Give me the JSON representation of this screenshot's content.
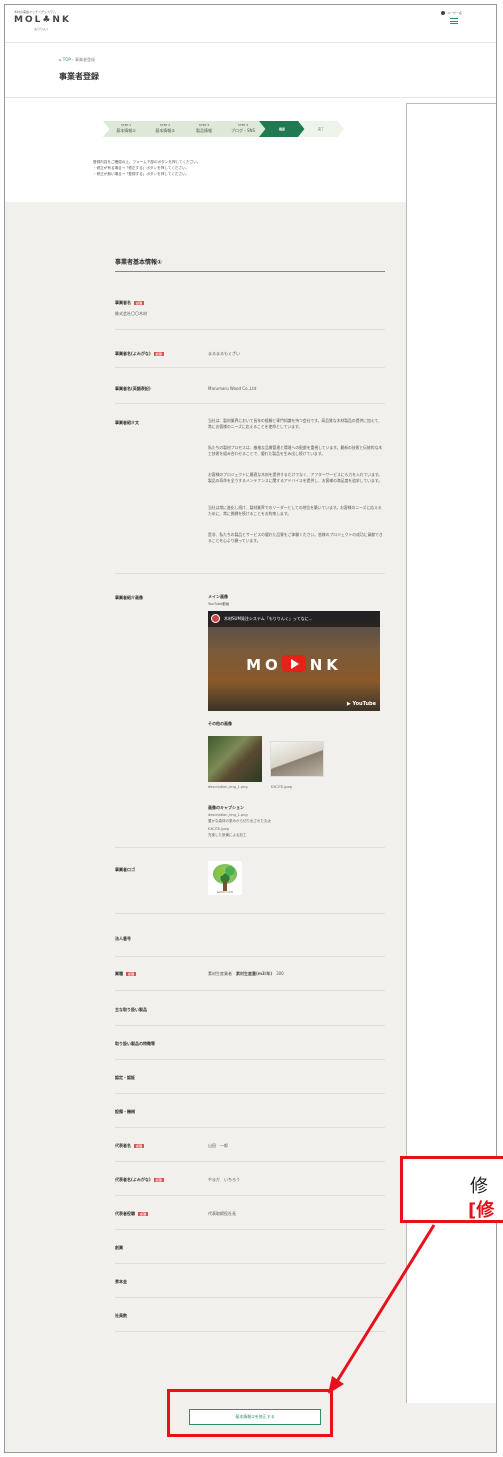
{
  "header": {
    "logo_top": "木材の需給マッチングシステム",
    "logo": "MOL♣NK",
    "logo_sub": "もりりんく",
    "user_label": "ユーザー名"
  },
  "breadcrumb": {
    "home": "⌂ TOP",
    "sep": "›",
    "current": "事業者登録"
  },
  "page_title": "事業者登録",
  "steps": [
    {
      "num": "STEP 1",
      "label": "基本情報①"
    },
    {
      "num": "STEP 2",
      "label": "基本情報②"
    },
    {
      "num": "STEP 3",
      "label": "製品情報"
    },
    {
      "num": "STEP 4",
      "label": "ブログ・SNS"
    },
    {
      "num": "",
      "label": "確認"
    },
    {
      "num": "",
      "label": "完了"
    }
  ],
  "instructions": [
    "登録内容をご確認の上、フォーム下部のボタンを押してください。",
    "・修正が有る場合→「修正する」ボタンを押してください。",
    "・修正が無い場合→「登録する」ボタンを押してください。"
  ],
  "section_title": "事業者基本情報①",
  "required_badge": "必須",
  "fields": {
    "company_name": {
      "label": "事業者名",
      "value": "株式会社〇〇木材"
    },
    "company_kana": {
      "label": "事業者名(よみがな)",
      "value": "まるまるもくざい"
    },
    "company_en": {
      "label": "事業者名(英語表記)",
      "value": "Marumaru Wood Co.,Ltd"
    },
    "intro": {
      "label": "事業者紹介文",
      "paragraphs": [
        "当社は、製材業界において長年の経験と専門知識を持つ会社です。高品質な木材製品の提供に加えて、常にお客様のニーズに応えることを使命としています。",
        "私たちの製材プロセスは、厳格な品質管理と環境への配慮を重視しています。最新の技術と伝統的な木工技術を組み合わせることで、優れた製品を生み出し続けています。",
        "お客様のプロジェクトに最適な木材を提供するだけでなく、アフターサービスにも力を入れています。製品の寿命を全うするメンテナンスに関するアドバイスを提供し、お客様の満足度を追求しています。",
        "当社は常に進化し続け、製材業界でのリーダーとしての地位を築いています。お客様のニーズに応えるために、常に挑戦を続けることをお約束します。",
        "是非、私たちの製品とサービスの優れた品質をご体験ください。皆様のプロジェクトの成功に貢献できることを心より願っています。"
      ]
    },
    "intro_image": {
      "label": "事業者紹介画像",
      "main_label": "メイン画像",
      "youtube_label": "YouTube動画",
      "video_title": "木材SUM発注システム「もりりんく」ってなに...",
      "video_logo_left": "MO",
      "video_logo_right": "NK",
      "youtube_mark": "▶ YouTube",
      "others_label": "その他の画像",
      "img1_caption": "description_img_1.png",
      "img2_caption": "EXCITE.jpeg",
      "caption_label": "画像のキャプション",
      "captions": [
        "description_img_1.png",
        "豊かな森林の恵みから切り出された丸太",
        "EXCITE.jpeg",
        "充実した設備による加工"
      ]
    },
    "logo": {
      "label": "事業者ロゴ",
      "logo_text": "株式会社〇〇木材"
    },
    "corp_number": {
      "label": "法人番号"
    },
    "business": {
      "label": "業種",
      "value1": "素材生産業者",
      "value2_label": "素材生産量(m3/年)",
      "value2": "300"
    },
    "main_products": {
      "label": "主な取り扱い製品"
    },
    "features": {
      "label": "取り扱い製品の特徴等"
    },
    "certs": {
      "label": "認定・認証"
    },
    "equipment": {
      "label": "設備・機械"
    },
    "rep_name": {
      "label": "代表者名",
      "value": "山田　一郎"
    },
    "rep_kana": {
      "label": "代表者名(よみがな)",
      "value": "やまだ　いちろう"
    },
    "rep_title": {
      "label": "代表者役職",
      "value": "代表取締役社長"
    },
    "founded": {
      "label": "創業"
    },
    "capital": {
      "label": "資本金"
    },
    "employees": {
      "label": "社員数"
    }
  },
  "bottom_button": "基本情報①を修正する",
  "callout": {
    "line1": "修",
    "line2": "[修"
  },
  "colors": {
    "accent": "#2e8f6a",
    "step_active": "#1f7a52",
    "callout_red": "#e8101a"
  }
}
